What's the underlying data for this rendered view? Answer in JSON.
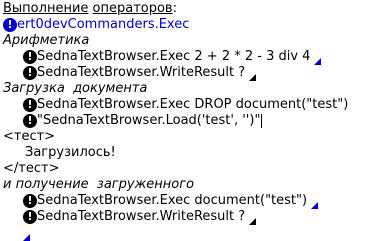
{
  "header": {
    "word1": "Выполнение",
    "word2": "операторов",
    "colon": ":"
  },
  "lines": {
    "exec_commanders": "ert0devCommanders.Exec",
    "section_arith": "Арифметика",
    "arith_exec": "SednaTextBrowser.Exec 2 + 2 * 2 - 3 div 4",
    "arith_write": "SednaTextBrowser.WriteResult ?",
    "section_load": "Загрузка  документа",
    "load_drop": "SednaTextBrowser.Exec DROP document(\"test\")",
    "load_load": "\"SednaTextBrowser.Load('test', '')\"",
    "xml_open": "<тест>",
    "xml_content": "Загрузилось!",
    "xml_close": "</тест>",
    "section_get": "и получение  загруженного",
    "get_exec": "SednaTextBrowser.Exec document(\"test\")",
    "get_write": "SednaTextBrowser.WriteResult ?"
  },
  "icons": {
    "bullet": "exclamation-bullet-icon",
    "marker": "triangle-marker-icon"
  },
  "colors": {
    "blue": "#0000d0",
    "black": "#000000"
  }
}
